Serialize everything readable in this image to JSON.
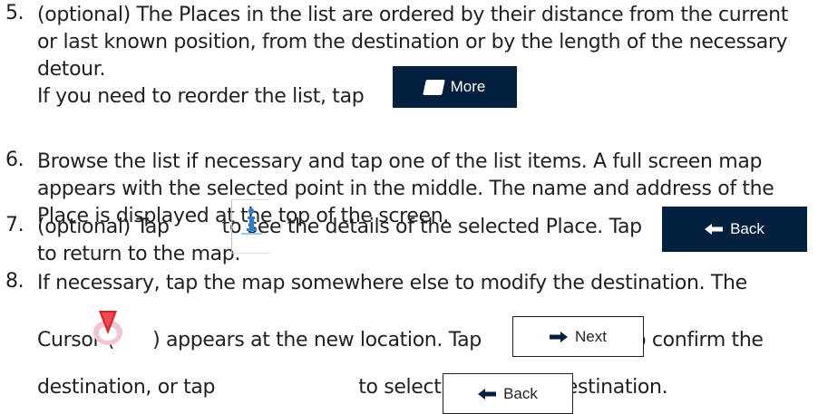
{
  "steps": [
    {
      "number": "5.",
      "lines": [
        "(optional) The Places in the list are ordered by their distance from the current",
        "or last known position, from the destination or by the length of the necessary",
        "detour.",
        "If you need to reorder the list, tap",
        "."
      ]
    },
    {
      "number": "6.",
      "lines": [
        "Browse the list if necessary and tap one of the list items. A full screen map",
        "appears with the selected point in the middle. The name and address of the",
        "Place is displayed at the top of the screen."
      ]
    },
    {
      "number": "7.",
      "lines": [
        "(optional) Tap",
        "to see the details of the selected Place. Tap",
        "to return to the map."
      ]
    },
    {
      "number": "8.",
      "lines": [
        "If necessary, tap the map somewhere else to modify the destination. The",
        "Cursor (",
        ") appears at the new location. Tap",
        "to confirm the",
        "destination, or tap",
        "to select a different destination."
      ]
    }
  ],
  "buttons": {
    "more": {
      "label": "More",
      "icon": "more-icon"
    },
    "back_dark": {
      "label": "Back",
      "icon": "arrow-left-icon"
    },
    "next": {
      "label": "Next",
      "icon": "arrow-right-icon"
    },
    "back_light": {
      "label": "Back",
      "icon": "arrow-left-icon"
    },
    "info": {
      "icon": "info-icon"
    },
    "cursor": {
      "icon": "map-cursor-icon"
    }
  },
  "colors": {
    "text": "#231f20",
    "button_dark": "#03213e",
    "cursor_red": "#d8232a",
    "cursor_pink": "#f2c6cf"
  }
}
